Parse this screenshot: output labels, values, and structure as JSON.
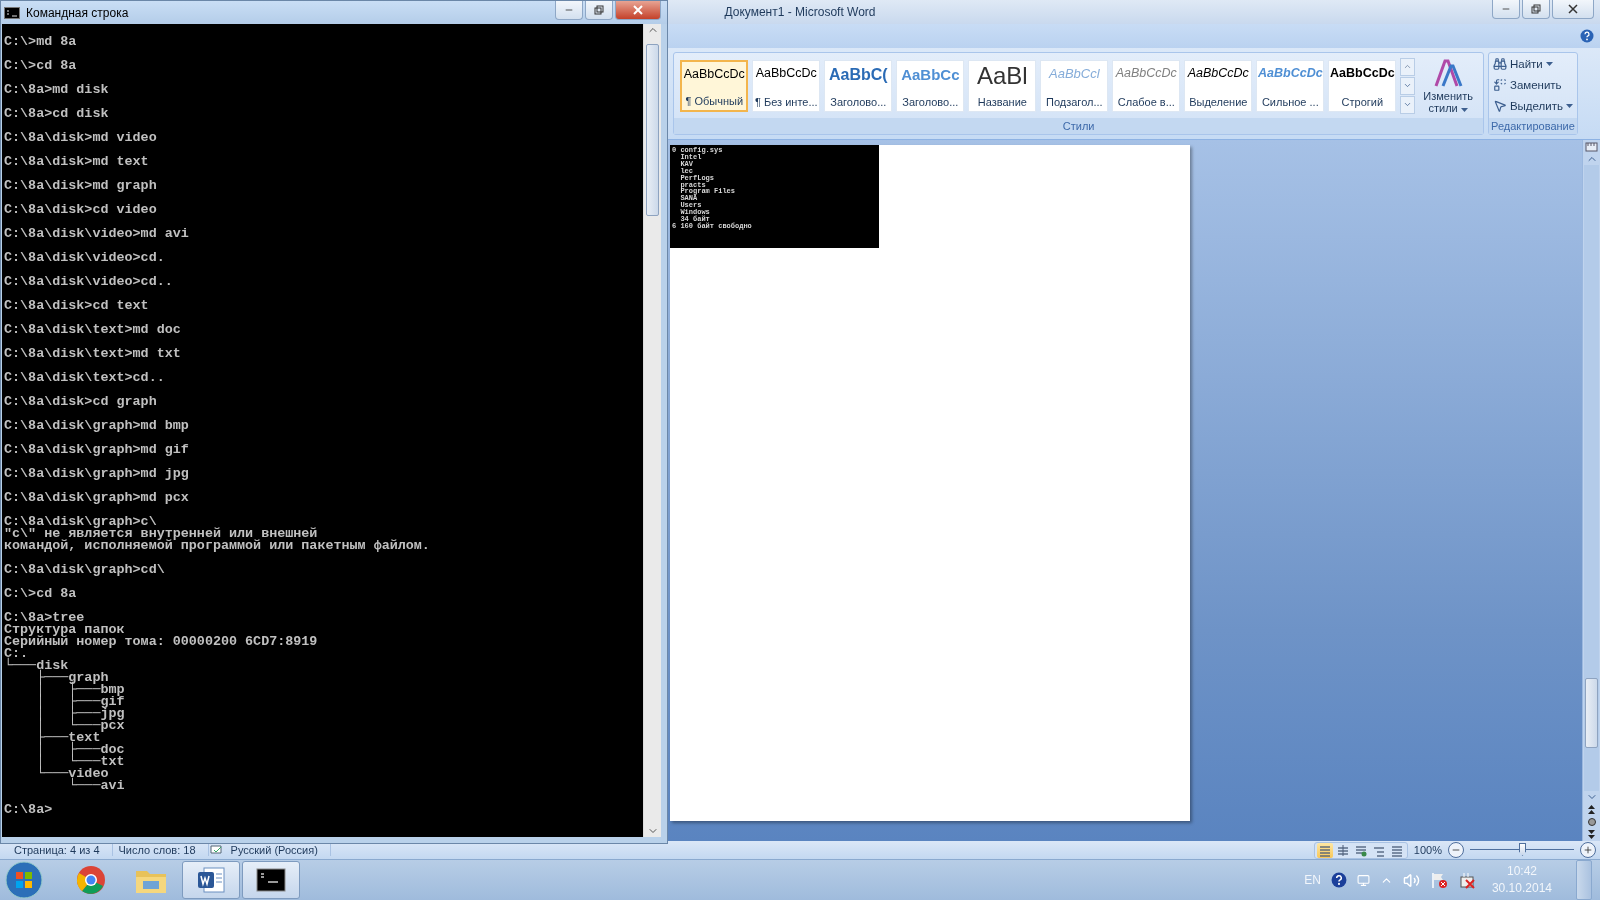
{
  "word": {
    "title": "Документ1 - Microsoft Word",
    "styles_group": {
      "label": "Стили",
      "items": [
        {
          "kind": "normal",
          "sample": "AaBbCcDc",
          "label": "¶ Обычный",
          "selected": true
        },
        {
          "kind": "normal",
          "sample": "AaBbCcDc",
          "label": "¶ Без инте...",
          "selected": false
        },
        {
          "kind": "heading1",
          "sample": "AaBbC(",
          "label": "Заголово...",
          "selected": false
        },
        {
          "kind": "heading2",
          "sample": "AaBbCc",
          "label": "Заголово...",
          "selected": false
        },
        {
          "kind": "title",
          "sample": "AaBl",
          "label": "Название",
          "selected": false
        },
        {
          "kind": "subtitle",
          "sample": "AaBbCcl",
          "label": "Подзагол...",
          "selected": false
        },
        {
          "kind": "subtle",
          "sample": "AaBbCcDc",
          "label": "Слабое в...",
          "selected": false
        },
        {
          "kind": "emphasis",
          "sample": "AaBbCcDc",
          "label": "Выделение",
          "selected": false
        },
        {
          "kind": "intense",
          "sample": "AaBbCcDc",
          "label": "Сильное ...",
          "selected": false
        },
        {
          "kind": "strong",
          "sample": "AaBbCcDc",
          "label": "Строгий",
          "selected": false
        }
      ],
      "change_styles": [
        "Изменить",
        "стили"
      ]
    },
    "editing_group": {
      "label": "Редактирование",
      "items": [
        {
          "kind": "find",
          "label": "Найти"
        },
        {
          "kind": "replace",
          "label": "Заменить"
        },
        {
          "kind": "select",
          "label": "Выделить"
        }
      ]
    },
    "embedded_screenshot": [
      "0 config.sys",
      "  Intel",
      "  KAV",
      "  lec",
      "  PerfLogs",
      "  practs",
      "  Program Files",
      "  SANA",
      "  Users",
      "  Windows",
      "  34 байт",
      "6 160 байт свободно"
    ],
    "status_bar": {
      "page": "Страница: 4 из 4",
      "words": "Число слов: 18",
      "language": "Русский (Россия)",
      "views": [
        {
          "kind": "print",
          "selected": true
        },
        {
          "kind": "reading",
          "selected": false
        },
        {
          "kind": "web",
          "selected": false
        },
        {
          "kind": "outline",
          "selected": false
        },
        {
          "kind": "draft",
          "selected": false
        }
      ],
      "zoom": "100%",
      "zoom_slider": {
        "level": 0.5
      }
    }
  },
  "console": {
    "title": "Командная строка",
    "blocks": [
      [
        "C:\\>md 8a"
      ],
      [
        "C:\\>cd 8a"
      ],
      [
        "C:\\8a>md disk"
      ],
      [
        "C:\\8a>cd disk"
      ],
      [
        "C:\\8a\\disk>md video"
      ],
      [
        "C:\\8a\\disk>md text"
      ],
      [
        "C:\\8a\\disk>md graph"
      ],
      [
        "C:\\8a\\disk>cd video"
      ],
      [
        "C:\\8a\\disk\\video>md avi"
      ],
      [
        "C:\\8a\\disk\\video>cd."
      ],
      [
        "C:\\8a\\disk\\video>cd.."
      ],
      [
        "C:\\8a\\disk>cd text"
      ],
      [
        "C:\\8a\\disk\\text>md doc"
      ],
      [
        "C:\\8a\\disk\\text>md txt"
      ],
      [
        "C:\\8a\\disk\\text>cd.."
      ],
      [
        "C:\\8a\\disk>cd graph"
      ],
      [
        "C:\\8a\\disk\\graph>md bmp"
      ],
      [
        "C:\\8a\\disk\\graph>md gif"
      ],
      [
        "C:\\8a\\disk\\graph>md jpg"
      ],
      [
        "C:\\8a\\disk\\graph>md pcx"
      ],
      [
        "C:\\8a\\disk\\graph>c\\",
        "\"c\\\" не является внутренней или внешней",
        "командой, исполняемой программой или пакетным файлом."
      ],
      [
        "C:\\8a\\disk\\graph>cd\\"
      ],
      [
        "C:\\>cd 8a"
      ],
      [
        "C:\\8a>tree",
        "Структура папок",
        "Серийный номер тома: 00000200 6CD7:8919",
        "C:.",
        "└───disk",
        "    ├───graph",
        "    │   ├───bmp",
        "    │   ├───gif",
        "    │   ├───jpg",
        "    │   └───pcx",
        "    ├───text",
        "    │   ├───doc",
        "    │   └───txt",
        "    └───video",
        "        └───avi"
      ],
      [
        "C:\\8a>"
      ]
    ]
  },
  "taskbar": {
    "apps": [
      {
        "kind": "browser",
        "running": false
      },
      {
        "kind": "explorer",
        "running": false
      },
      {
        "kind": "word",
        "running": true
      },
      {
        "kind": "console",
        "running": true
      }
    ],
    "tray": {
      "language": "EN",
      "time": "10:42",
      "date": "30.10.2014"
    }
  }
}
